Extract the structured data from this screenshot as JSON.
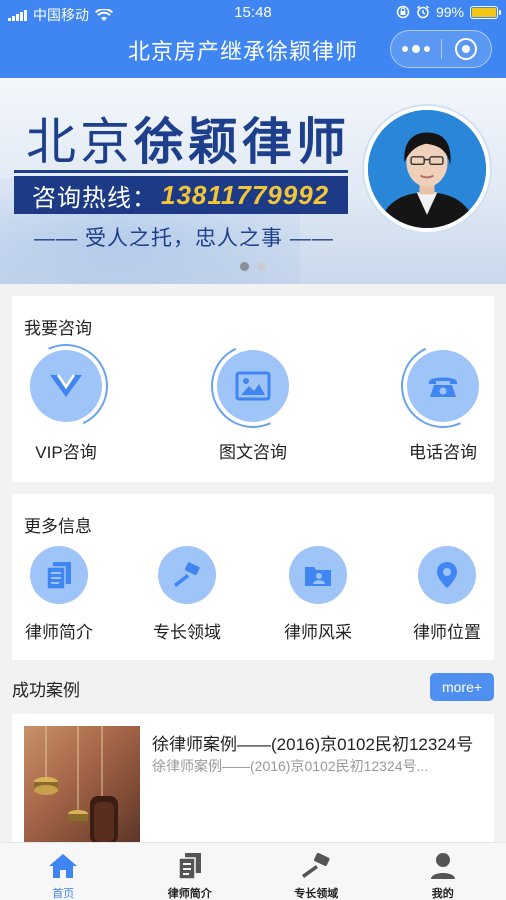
{
  "status_bar": {
    "carrier": "中国移动",
    "time": "15:48",
    "battery": "99%"
  },
  "nav": {
    "title": "北京房产继承徐颖律师"
  },
  "banner": {
    "title_plain": "北京",
    "title_bold": "徐颖律师",
    "hotline_label": "咨询热线：",
    "hotline_number": "13811779992",
    "slogan": "—— 受人之托，忠人之事 ——",
    "pager_count": 2,
    "pager_active": 0
  },
  "consult": {
    "title": "我要咨询",
    "items": [
      {
        "label": "VIP咨询",
        "icon": "vip-icon"
      },
      {
        "label": "图文咨询",
        "icon": "image-icon"
      },
      {
        "label": "电话咨询",
        "icon": "phone-icon"
      }
    ]
  },
  "more_info": {
    "title": "更多信息",
    "items": [
      {
        "label": "律师简介",
        "icon": "document-icon"
      },
      {
        "label": "专长领域",
        "icon": "gavel-icon"
      },
      {
        "label": "律师风采",
        "icon": "folder-person-icon"
      },
      {
        "label": "律师位置",
        "icon": "location-icon"
      }
    ]
  },
  "cases": {
    "title": "成功案例",
    "more_label": "more+",
    "items": [
      {
        "title": "徐律师案例——(2016)京0102民初12324号",
        "subtitle": "徐律师案例——(2016)京0102民初12324号..."
      }
    ]
  },
  "tabbar": {
    "items": [
      {
        "label": "首页",
        "icon": "home-icon",
        "active": true
      },
      {
        "label": "律师简介",
        "icon": "document-icon",
        "active": false
      },
      {
        "label": "专长领域",
        "icon": "gavel-icon",
        "active": false
      },
      {
        "label": "我的",
        "icon": "user-icon",
        "active": false
      }
    ]
  },
  "colors": {
    "primary": "#3f86f2",
    "icon_circle": "#9fc4f7",
    "banner_navy": "#1e3f8c",
    "hotline_gold": "#f3c63a"
  }
}
